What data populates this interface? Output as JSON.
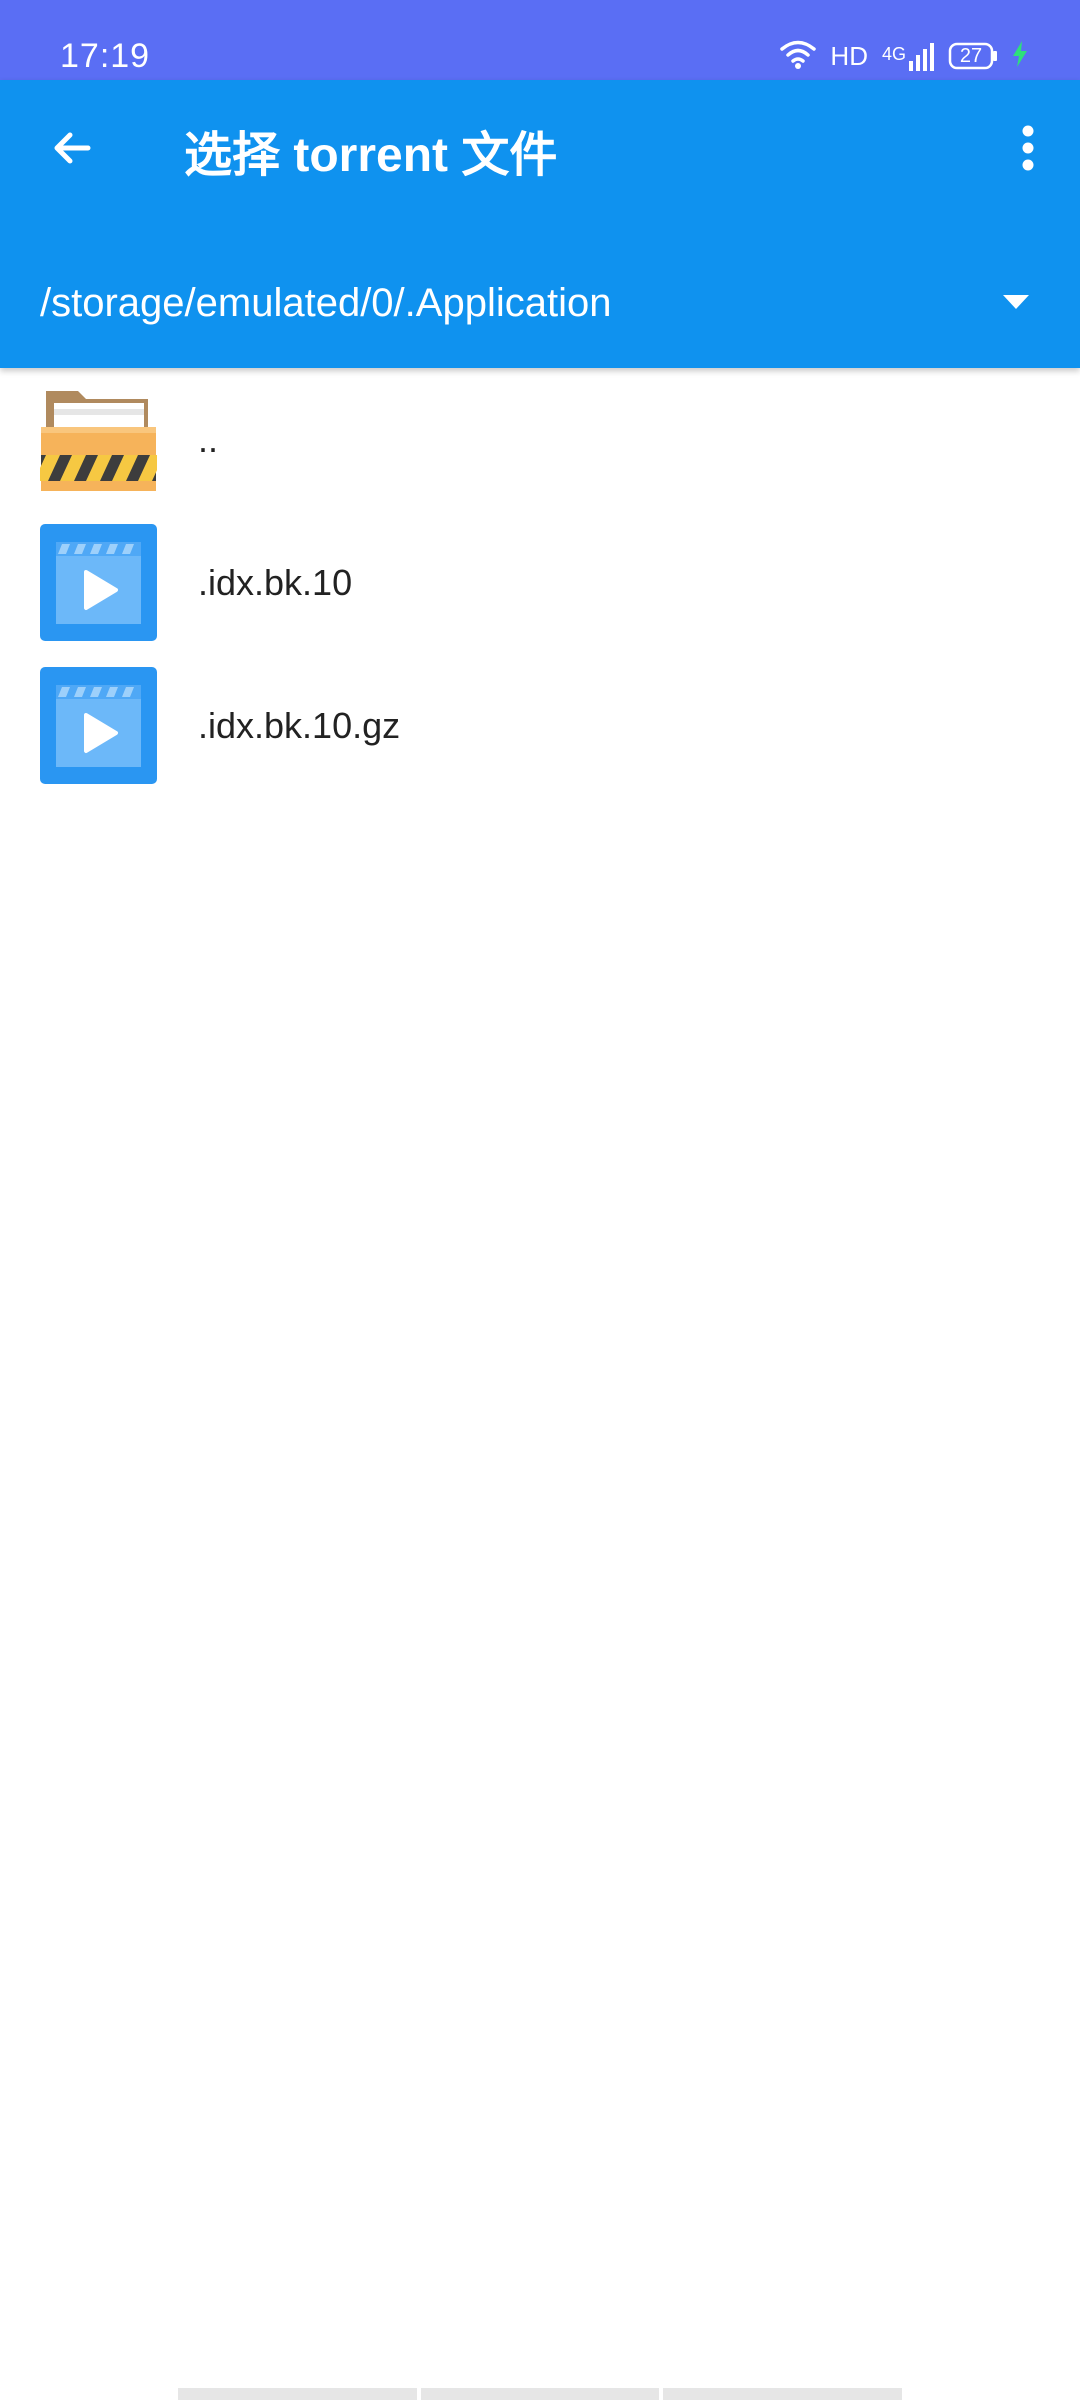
{
  "status_bar": {
    "time": "17:19",
    "hd_label": "HD",
    "network_label": "4G",
    "battery_level": "27",
    "icons": [
      "wifi-icon",
      "signal-icon",
      "battery-icon",
      "charging-icon"
    ]
  },
  "toolbar": {
    "title": "选择 torrent 文件",
    "back_icon": "arrow-left-icon",
    "more_icon": "more-vertical-icon"
  },
  "path_selector": {
    "current_path": "/storage/emulated/0/.Application",
    "dropdown_icon": "triangle-down-icon"
  },
  "files": [
    {
      "name": "..",
      "icon": "folder-up-icon"
    },
    {
      "name": ".idx.bk.10",
      "icon": "video-file-icon"
    },
    {
      "name": ".idx.bk.10.gz",
      "icon": "video-file-icon"
    }
  ],
  "colors": {
    "status_bar": "#5a6ef4",
    "app_bar": "#0f92ef",
    "file_icon_blue": "#2a96f2",
    "folder_orange": "#f6b35a",
    "charging_green": "#2ee07a"
  }
}
